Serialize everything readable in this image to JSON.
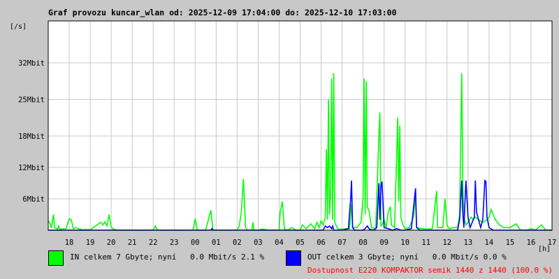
{
  "colors": {
    "background": "#c8c8c8",
    "plot_background": "#ffffff",
    "grid": "#c8c8c8",
    "in_series": "#00ff00",
    "out_series": "#0000ff",
    "availability_text": "#ff0000"
  },
  "legend": {
    "in_text": "IN celkem 7 Gbyte; nyní   0.0 Mbit/s 2.1 %",
    "out_text": "OUT celkem 3 Gbyte; nyní   0.0 Mbit/s 0.0 %",
    "availability_text": "Dostupnost E220 KOMPAKTOR semik 1440 z 1440 (100.0 %)"
  },
  "chart_data": {
    "type": "line",
    "title": "Graf provozu kuncar_wlan od: 2025-12-09 17:04:00 do: 2025-12-10 17:03:00",
    "ylabel": "[/s]",
    "xlabel": "[h]",
    "ylim": [
      0,
      40
    ],
    "y_ticks": [
      6,
      12,
      18,
      25,
      32
    ],
    "y_tick_labels": [
      "6Mbit",
      "12Mbit",
      "18Mbit",
      "25Mbit",
      "32Mbit"
    ],
    "x_range": [
      17,
      41
    ],
    "x_ticks": [
      18,
      19,
      20,
      21,
      22,
      23,
      24,
      25,
      26,
      27,
      28,
      29,
      30,
      31,
      32,
      33,
      34,
      35,
      36,
      37,
      38,
      39,
      40,
      41
    ],
    "x_tick_labels": [
      "18",
      "19",
      "20",
      "21",
      "22",
      "23",
      "00",
      "01",
      "02",
      "03",
      "04",
      "05",
      "06",
      "07",
      "08",
      "09",
      "10",
      "11",
      "12",
      "13",
      "14",
      "15",
      "16",
      "17"
    ],
    "grid": true,
    "series": [
      {
        "name": "IN",
        "color": "#00ff00",
        "points": [
          [
            17.0,
            1.8
          ],
          [
            17.1,
            1.2
          ],
          [
            17.15,
            0.4
          ],
          [
            17.25,
            3.0
          ],
          [
            17.3,
            0.5
          ],
          [
            17.45,
            0.2
          ],
          [
            17.5,
            0.8
          ],
          [
            17.55,
            0.2
          ],
          [
            17.85,
            0.3
          ],
          [
            18.0,
            2.2
          ],
          [
            18.1,
            2.0
          ],
          [
            18.2,
            0.3
          ],
          [
            18.3,
            0.5
          ],
          [
            18.6,
            0.1
          ],
          [
            19.0,
            0.1
          ],
          [
            19.5,
            1.5
          ],
          [
            19.6,
            1.0
          ],
          [
            19.7,
            1.6
          ],
          [
            19.8,
            0.8
          ],
          [
            19.9,
            3.0
          ],
          [
            20.0,
            0.6
          ],
          [
            20.1,
            0.2
          ],
          [
            20.3,
            0.0
          ],
          [
            21.0,
            0.0
          ],
          [
            22.0,
            0.0
          ],
          [
            22.1,
            0.8
          ],
          [
            22.2,
            0.0
          ],
          [
            23.0,
            0.0
          ],
          [
            23.9,
            0.0
          ],
          [
            24.0,
            2.2
          ],
          [
            24.1,
            0.0
          ],
          [
            24.5,
            0.0
          ],
          [
            24.75,
            3.8
          ],
          [
            24.85,
            0.0
          ],
          [
            25.5,
            0.0
          ],
          [
            26.0,
            0.0
          ],
          [
            26.1,
            0.8
          ],
          [
            26.2,
            3.5
          ],
          [
            26.3,
            9.8
          ],
          [
            26.4,
            0.5
          ],
          [
            26.5,
            0.0
          ],
          [
            26.7,
            0.0
          ],
          [
            26.75,
            1.5
          ],
          [
            26.8,
            0.0
          ],
          [
            27.0,
            0.0
          ],
          [
            27.2,
            0.2
          ],
          [
            27.5,
            0.0
          ],
          [
            28.0,
            0.0
          ],
          [
            28.05,
            3.5
          ],
          [
            28.15,
            5.5
          ],
          [
            28.25,
            0.2
          ],
          [
            28.4,
            0.0
          ],
          [
            28.6,
            0.5
          ],
          [
            28.8,
            0.0
          ],
          [
            29.0,
            0.0
          ],
          [
            29.1,
            1.0
          ],
          [
            29.3,
            0.3
          ],
          [
            29.5,
            1.2
          ],
          [
            29.7,
            0.3
          ],
          [
            29.8,
            1.5
          ],
          [
            29.9,
            0.5
          ],
          [
            30.0,
            1.8
          ],
          [
            30.1,
            1.0
          ],
          [
            30.2,
            2.5
          ],
          [
            30.25,
            15.5
          ],
          [
            30.3,
            2.0
          ],
          [
            30.35,
            25.0
          ],
          [
            30.4,
            3.0
          ],
          [
            30.45,
            6.5
          ],
          [
            30.5,
            29.0
          ],
          [
            30.55,
            2.0
          ],
          [
            30.6,
            30.0
          ],
          [
            30.65,
            1.5
          ],
          [
            30.7,
            1.0
          ],
          [
            30.8,
            0.2
          ],
          [
            31.0,
            0.2
          ],
          [
            31.2,
            0.3
          ],
          [
            31.35,
            0.2
          ],
          [
            31.45,
            5.0
          ],
          [
            31.5,
            0.5
          ],
          [
            31.7,
            0.5
          ],
          [
            31.9,
            1.5
          ],
          [
            32.0,
            6.0
          ],
          [
            32.05,
            29.0
          ],
          [
            32.1,
            3.0
          ],
          [
            32.15,
            28.5
          ],
          [
            32.2,
            4.5
          ],
          [
            32.3,
            3.5
          ],
          [
            32.4,
            0.5
          ],
          [
            32.6,
            0.3
          ],
          [
            32.75,
            18.0
          ],
          [
            32.8,
            22.5
          ],
          [
            32.85,
            0.8
          ],
          [
            32.9,
            1.0
          ],
          [
            33.0,
            2.0
          ],
          [
            33.1,
            0.5
          ],
          [
            33.2,
            3.5
          ],
          [
            33.3,
            4.5
          ],
          [
            33.35,
            1.0
          ],
          [
            33.5,
            0.5
          ],
          [
            33.65,
            21.5
          ],
          [
            33.7,
            5.5
          ],
          [
            33.75,
            20.0
          ],
          [
            33.8,
            2.5
          ],
          [
            33.9,
            1.0
          ],
          [
            34.0,
            0.3
          ],
          [
            34.2,
            0.5
          ],
          [
            34.4,
            2.5
          ],
          [
            34.5,
            6.5
          ],
          [
            34.55,
            0.5
          ],
          [
            34.8,
            0.3
          ],
          [
            35.0,
            0.2
          ],
          [
            35.3,
            0.3
          ],
          [
            35.5,
            7.5
          ],
          [
            35.55,
            0.5
          ],
          [
            35.8,
            0.5
          ],
          [
            35.9,
            6.0
          ],
          [
            36.0,
            1.0
          ],
          [
            36.1,
            0.3
          ],
          [
            36.3,
            0.5
          ],
          [
            36.5,
            0.5
          ],
          [
            36.6,
            3.0
          ],
          [
            36.7,
            30.0
          ],
          [
            36.75,
            9.0
          ],
          [
            36.8,
            2.5
          ],
          [
            36.9,
            1.0
          ],
          [
            37.0,
            1.5
          ],
          [
            37.15,
            2.5
          ],
          [
            37.25,
            2.0
          ],
          [
            37.35,
            2.5
          ],
          [
            37.5,
            2.0
          ],
          [
            37.7,
            1.5
          ],
          [
            37.9,
            2.0
          ],
          [
            38.0,
            2.5
          ],
          [
            38.1,
            4.0
          ],
          [
            38.3,
            2.0
          ],
          [
            38.5,
            1.0
          ],
          [
            38.7,
            0.5
          ],
          [
            39.0,
            0.5
          ],
          [
            39.3,
            1.2
          ],
          [
            39.5,
            0.0
          ],
          [
            39.8,
            0.0
          ],
          [
            40.0,
            0.3
          ],
          [
            40.2,
            0.0
          ],
          [
            40.5,
            1.0
          ],
          [
            40.7,
            0.0
          ],
          [
            41.0,
            0.0
          ]
        ]
      },
      {
        "name": "OUT",
        "color": "#0000ff",
        "points": [
          [
            17.0,
            0.0
          ],
          [
            24.75,
            0.0
          ],
          [
            24.8,
            0.3
          ],
          [
            24.85,
            0.0
          ],
          [
            30.1,
            0.0
          ],
          [
            30.2,
            0.8
          ],
          [
            30.3,
            0.5
          ],
          [
            30.4,
            0.8
          ],
          [
            30.5,
            0.3
          ],
          [
            30.55,
            0.8
          ],
          [
            30.6,
            0.0
          ],
          [
            31.0,
            0.0
          ],
          [
            31.3,
            0.3
          ],
          [
            31.4,
            5.5
          ],
          [
            31.45,
            9.5
          ],
          [
            31.5,
            0.5
          ],
          [
            31.6,
            0.0
          ],
          [
            32.0,
            0.0
          ],
          [
            32.1,
            0.3
          ],
          [
            32.2,
            0.8
          ],
          [
            32.3,
            0.2
          ],
          [
            32.5,
            0.0
          ],
          [
            32.65,
            0.5
          ],
          [
            32.75,
            9.0
          ],
          [
            32.8,
            2.0
          ],
          [
            32.85,
            8.5
          ],
          [
            32.9,
            9.3
          ],
          [
            33.0,
            0.5
          ],
          [
            33.2,
            0.3
          ],
          [
            33.4,
            0.0
          ],
          [
            33.6,
            0.3
          ],
          [
            33.8,
            0.0
          ],
          [
            34.0,
            0.0
          ],
          [
            34.3,
            0.3
          ],
          [
            34.5,
            8.0
          ],
          [
            34.55,
            0.5
          ],
          [
            34.7,
            0.0
          ],
          [
            36.0,
            0.0
          ],
          [
            36.5,
            0.0
          ],
          [
            36.6,
            2.0
          ],
          [
            36.7,
            9.5
          ],
          [
            36.75,
            3.5
          ],
          [
            36.8,
            0.5
          ],
          [
            36.9,
            9.5
          ],
          [
            37.0,
            2.5
          ],
          [
            37.1,
            0.5
          ],
          [
            37.2,
            1.5
          ],
          [
            37.3,
            2.5
          ],
          [
            37.35,
            9.5
          ],
          [
            37.4,
            3.5
          ],
          [
            37.5,
            2.0
          ],
          [
            37.6,
            0.5
          ],
          [
            37.7,
            2.0
          ],
          [
            37.8,
            9.5
          ],
          [
            37.85,
            9.3
          ],
          [
            37.9,
            2.5
          ],
          [
            38.0,
            0.5
          ],
          [
            38.2,
            0.0
          ],
          [
            41.0,
            0.0
          ]
        ]
      }
    ]
  }
}
